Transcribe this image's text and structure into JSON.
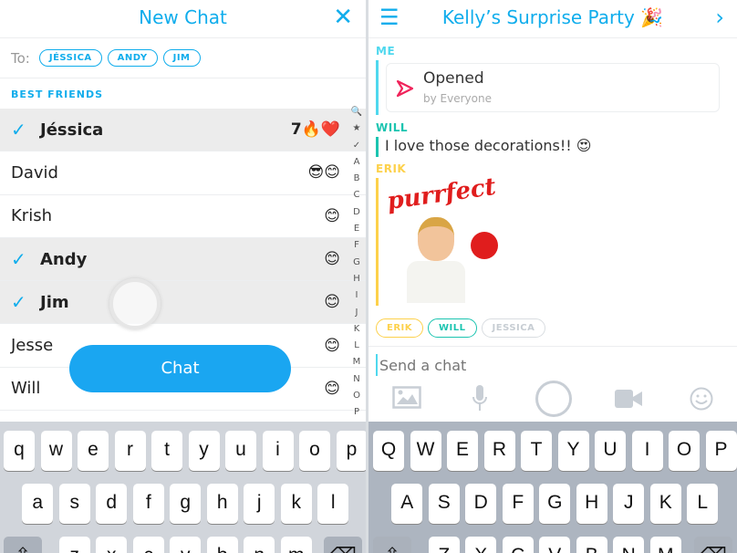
{
  "left": {
    "title": "New Chat",
    "close_icon": "close-icon",
    "to_label": "To:",
    "recipients": [
      "JÉSSICA",
      "ANDY",
      "JIM"
    ],
    "section": "BEST FRIENDS",
    "friends": [
      {
        "name": "Jéssica",
        "selected": true,
        "emoji": "7🔥❤️"
      },
      {
        "name": "David",
        "selected": false,
        "emoji": "😎😊"
      },
      {
        "name": "Krish",
        "selected": false,
        "emoji": "😊"
      },
      {
        "name": "Andy",
        "selected": true,
        "emoji": "😊"
      },
      {
        "name": "Jim",
        "selected": true,
        "emoji": "😊"
      },
      {
        "name": "Jesse",
        "selected": false,
        "emoji": "😊"
      },
      {
        "name": "Will",
        "selected": false,
        "emoji": "😊"
      }
    ],
    "index": [
      "🔍",
      "★",
      "✓",
      "A",
      "B",
      "C",
      "D",
      "E",
      "F",
      "G",
      "H",
      "I",
      "J",
      "K",
      "L",
      "M",
      "N",
      "O",
      "P"
    ],
    "chat_button": "Chat",
    "check": "✓",
    "keyboard": [
      [
        "q",
        "w",
        "e",
        "r",
        "t",
        "y",
        "u",
        "i",
        "o",
        "p"
      ],
      [
        "a",
        "s",
        "d",
        "f",
        "g",
        "h",
        "j",
        "k",
        "l"
      ],
      [
        "z",
        "x",
        "c",
        "v",
        "b",
        "n",
        "m"
      ]
    ]
  },
  "right": {
    "title": "Kelly’s Surprise Party 🎉",
    "menu_icon": "menu-icon",
    "forward_icon": "chevron-right-icon",
    "messages": [
      {
        "sender": "ME",
        "status": "Opened",
        "sub": "by Everyone"
      },
      {
        "sender": "WILL",
        "text": "I love those decorations!! 😍"
      },
      {
        "sender": "ERIK",
        "sticker": "purrfect"
      }
    ],
    "present": [
      {
        "name": "ERIK",
        "color": "#fdd14b"
      },
      {
        "name": "WILL",
        "color": "#1bc4b0"
      },
      {
        "name": "JESSICA",
        "color": "#c7cdd3"
      }
    ],
    "input_placeholder": "Send a chat",
    "keyboard": [
      [
        "Q",
        "W",
        "E",
        "R",
        "T",
        "Y",
        "U",
        "I",
        "O",
        "P"
      ],
      [
        "A",
        "S",
        "D",
        "F",
        "G",
        "H",
        "J",
        "K",
        "L"
      ],
      [
        "Z",
        "X",
        "C",
        "V",
        "B",
        "N",
        "M"
      ]
    ]
  },
  "colors": {
    "accent": "#10adec",
    "me": "#4fd8ee",
    "will": "#1bc4b0",
    "erik": "#fdd14b",
    "opened": "#f0245b"
  }
}
